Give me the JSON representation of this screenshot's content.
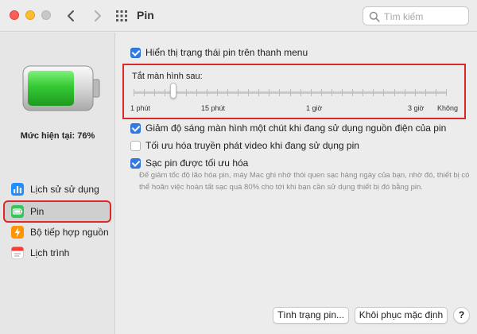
{
  "window": {
    "title": "Pin",
    "search_placeholder": "Tìm kiếm"
  },
  "icons": {
    "back": "chevron-left-icon",
    "forward": "chevron-right-icon",
    "grid": "grid-icon",
    "search": "magnifier-icon",
    "battery": "battery-icon"
  },
  "colors": {
    "accent": "#2f7ae5",
    "battery_green": "#35c934",
    "highlight_red": "#d9292b"
  },
  "battery": {
    "level_text": "Mức hiện tại: 76%",
    "level_fraction": 0.76
  },
  "sidebar": {
    "items": [
      {
        "label": "Lịch sử sử dụng",
        "icon": "usage-history-icon",
        "selected": false
      },
      {
        "label": "Pin",
        "icon": "battery-icon",
        "selected": true
      },
      {
        "label": "Bộ tiếp hợp nguồn",
        "icon": "power-adapter-icon",
        "selected": false
      },
      {
        "label": "Lịch trình",
        "icon": "schedule-icon",
        "selected": false
      }
    ]
  },
  "main": {
    "show_in_menubar": {
      "label": "Hiển thị trạng thái pin trên thanh menu",
      "checked": true
    },
    "sleep": {
      "title": "Tắt màn hình sau:",
      "labels": [
        "1 phút",
        "15 phút",
        "1 giờ",
        "3 giờ",
        "Không"
      ],
      "value": "2 phút"
    },
    "dim_display": {
      "label": "Giảm độ sáng màn hình một chút khi đang sử dụng nguồn điện của pin",
      "checked": true
    },
    "optimize_video": {
      "label": "Tối ưu hóa truyền phát video khi đang sử dụng pin",
      "checked": false
    },
    "optimized_charging": {
      "label": "Sạc pin được tối ưu hóa",
      "checked": true,
      "description": "Để giảm tốc độ lão hóa pin, máy Mac ghi nhớ thói quen sạc hàng ngày của bạn, nhờ đó, thiết bị có thể hoãn việc hoàn tất sạc quá 80% cho tới khi bạn cần sử dụng thiết bị đó bằng pin."
    },
    "buttons": {
      "status": "Tình trạng pin...",
      "restore": "Khôi phục mặc định",
      "help": "?"
    }
  }
}
